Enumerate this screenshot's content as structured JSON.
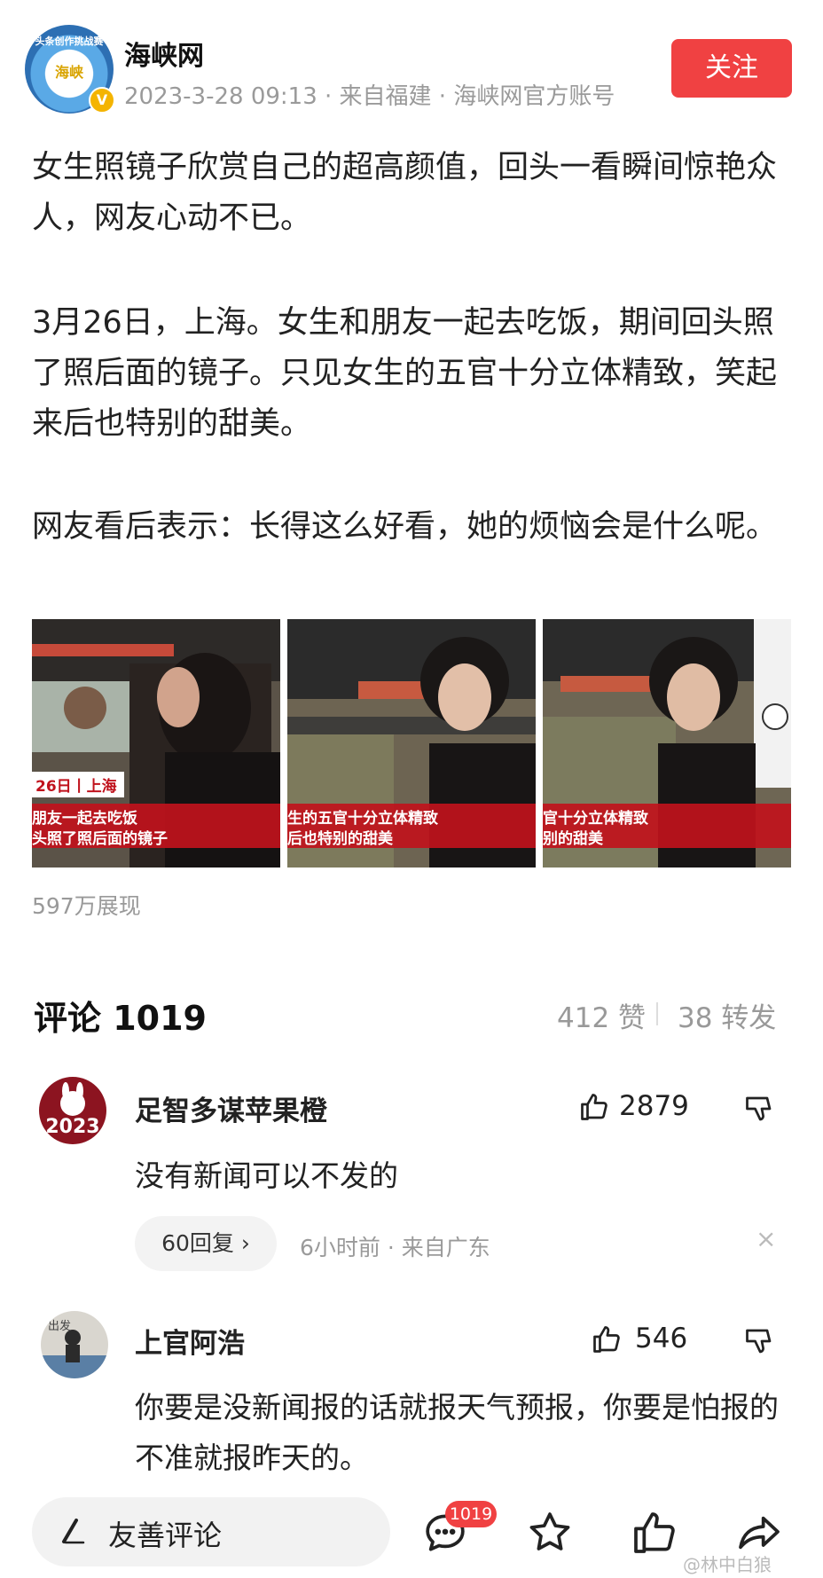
{
  "header": {
    "avatar_ring_text": "头条创作挑战赛",
    "avatar_inner_text": "海峡",
    "verified_mark": "V",
    "author": "海峡网",
    "meta": "2023-3-28 09:13 · 来自福建 · 海峡网官方账号",
    "follow_label": "关注"
  },
  "article": {
    "paragraphs": [
      "女生照镜子欣赏自己的超高颜值，回头一看瞬间惊艳众人，网友心动不已。",
      "3月26日，上海。女生和朋友一起去吃饭，期间回头照了照后面的镜子。只见女生的五官十分立体精致，笑起来后也特别的甜美。",
      "网友看后表示：长得这么好看，她的烦恼会是什么呢。"
    ],
    "images": [
      {
        "date_tag": "26日丨上海",
        "caption_1": "朋友一起去吃饭",
        "caption_2": "头照了照后面的镜子"
      },
      {
        "caption_1": "生的五官十分立体精致",
        "caption_2": "后也特别的甜美"
      },
      {
        "caption_1": "官十分立体精致",
        "caption_2": "别的甜美"
      }
    ],
    "views": "597万展现"
  },
  "comments_section": {
    "title": "评论 1019",
    "likes_count": "412 赞",
    "shares_count": "38 转发",
    "comments": [
      {
        "avatar_text": "2023",
        "username": "足智多谋苹果橙",
        "likes": "2879",
        "text": "没有新闻可以不发的",
        "replies_label": "60回复 ›",
        "time_location": "6小时前 · 来自广东",
        "close_glyph": "×"
      },
      {
        "avatar_text": "出发",
        "username": "上官阿浩",
        "likes": "546",
        "text": "你要是没新闻报的话就报天气预报，你要是怕报的不准就报昨天的。"
      }
    ]
  },
  "bottom_bar": {
    "input_placeholder": "友善评论",
    "comment_badge": "1019",
    "icons": [
      "pen-icon",
      "comment-icon",
      "star-icon",
      "thumbs-up-icon",
      "share-icon"
    ]
  },
  "watermark": "@林中白狼",
  "colors": {
    "accent": "#f04142",
    "muted": "#9a9a9a",
    "caption_bar": "#c0121c"
  }
}
